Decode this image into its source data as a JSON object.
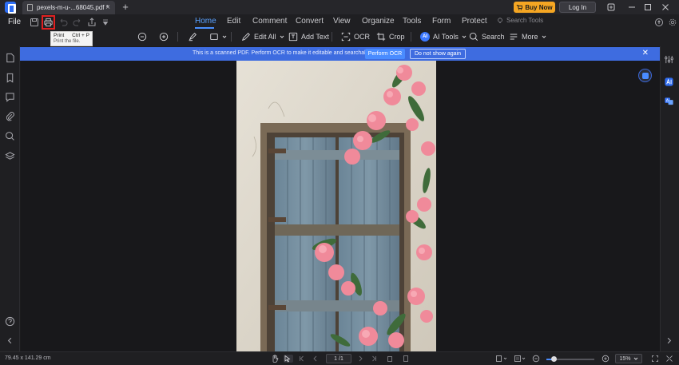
{
  "tab": {
    "title": "pexels-m-u-...68045.pdf *"
  },
  "title_actions": {
    "buy_now": "Buy Now",
    "log_in": "Log In"
  },
  "menu": {
    "file": "File",
    "items": [
      "Home",
      "Edit",
      "Comment",
      "Convert",
      "View",
      "Organize",
      "Tools",
      "Form",
      "Protect"
    ],
    "active": "Home",
    "search_tools": "Search Tools"
  },
  "tooltip": {
    "title": "Print",
    "shortcut": "Ctrl + P",
    "description": "Print the file."
  },
  "toolbar": {
    "edit_all": "Edit All",
    "add_text": "Add Text",
    "ocr": "OCR",
    "crop": "Crop",
    "ai_tools": "AI Tools",
    "ai_badge": "AI",
    "search": "Search",
    "more": "More"
  },
  "ocr_banner": {
    "message": "This is a scanned PDF. Perform OCR to make it editable and searchable.",
    "perform": "Perform OCR",
    "dismiss": "Do not show again"
  },
  "status": {
    "dimensions": "79.45 x 141.29 cm",
    "page": "1 /1",
    "zoom": "15%",
    "zoom_level": 0.15
  },
  "colors": {
    "accent": "#4a90ff",
    "banner": "#3e6ce0",
    "buy_now": "#f5a623",
    "highlight": "#e02020"
  }
}
